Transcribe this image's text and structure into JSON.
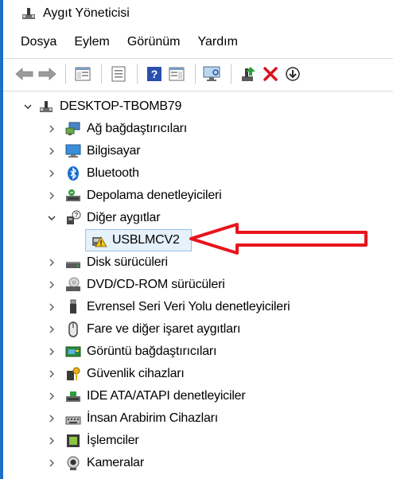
{
  "window": {
    "title": "Aygıt Yöneticisi"
  },
  "menu": {
    "items": [
      "Dosya",
      "Eylem",
      "Görünüm",
      "Yardım"
    ]
  },
  "tree": {
    "root": "DESKTOP-TBOMB79",
    "categories": [
      {
        "label": "Ağ bağdaştırıcıları",
        "icon": "network-adapter-icon",
        "expanded": false
      },
      {
        "label": "Bilgisayar",
        "icon": "computer-icon",
        "expanded": false
      },
      {
        "label": "Bluetooth",
        "icon": "bluetooth-icon",
        "expanded": false
      },
      {
        "label": "Depolama denetleyicileri",
        "icon": "storage-controller-icon",
        "expanded": false
      },
      {
        "label": "Diğer aygıtlar",
        "icon": "other-devices-icon",
        "expanded": true,
        "children": [
          "USBLMCV2"
        ]
      },
      {
        "label": "Disk sürücüleri",
        "icon": "disk-drive-icon",
        "expanded": false
      },
      {
        "label": "DVD/CD-ROM sürücüleri",
        "icon": "dvd-drive-icon",
        "expanded": false
      },
      {
        "label": "Evrensel Seri Veri Yolu denetleyicileri",
        "icon": "usb-controller-icon",
        "expanded": false
      },
      {
        "label": "Fare ve diğer işaret aygıtları",
        "icon": "mouse-icon",
        "expanded": false
      },
      {
        "label": "Görüntü bağdaştırıcıları",
        "icon": "display-adapter-icon",
        "expanded": false
      },
      {
        "label": "Güvenlik cihazları",
        "icon": "security-device-icon",
        "expanded": false
      },
      {
        "label": "IDE ATA/ATAPI denetleyiciler",
        "icon": "ide-controller-icon",
        "expanded": false
      },
      {
        "label": "İnsan Arabirim Cihazları",
        "icon": "hid-icon",
        "expanded": false
      },
      {
        "label": "İşlemciler",
        "icon": "processor-icon",
        "expanded": false
      },
      {
        "label": "Kameralar",
        "icon": "camera-icon",
        "expanded": false
      }
    ]
  },
  "colors": {
    "accent": "#1c6fc9",
    "annotation": "#e8141e",
    "warning": "#f5c518"
  }
}
